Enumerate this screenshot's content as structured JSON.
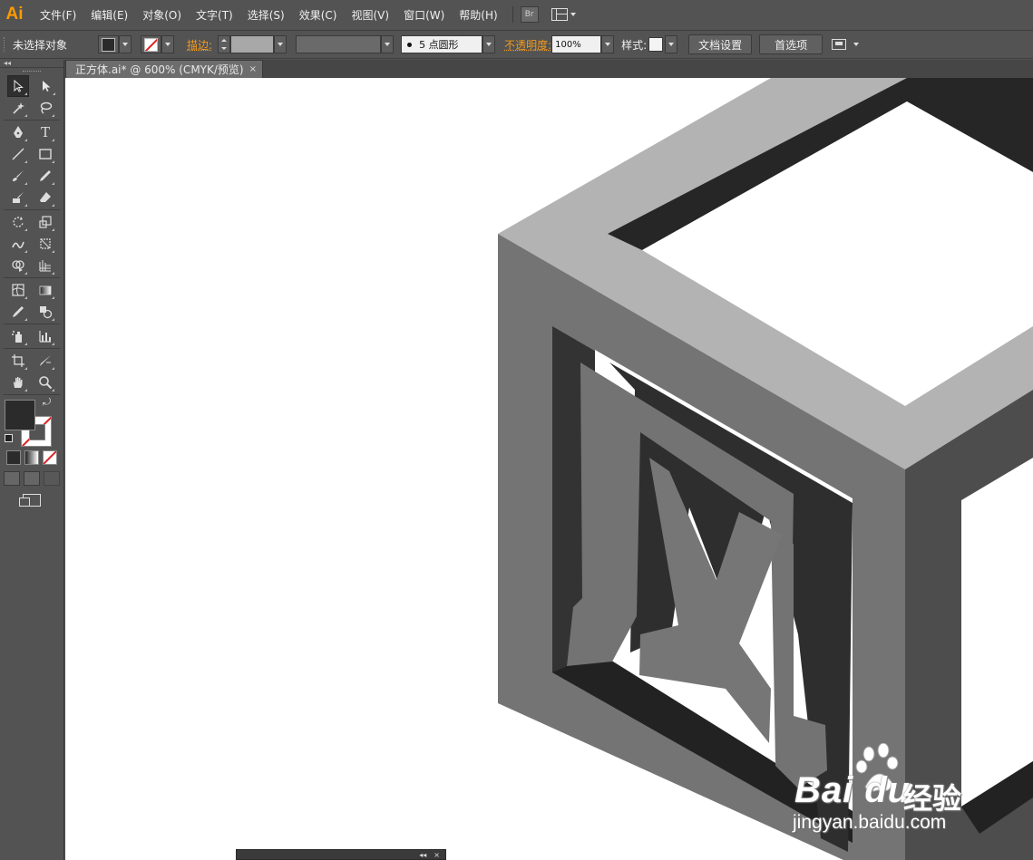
{
  "app": {
    "logo": "Ai",
    "menu": [
      "文件(F)",
      "编辑(E)",
      "对象(O)",
      "文字(T)",
      "选择(S)",
      "效果(C)",
      "视图(V)",
      "窗口(W)",
      "帮助(H)"
    ],
    "bridge_label": "Br"
  },
  "control_bar": {
    "selection_status": "未选择对象",
    "stroke_label": "描边:",
    "brush_size": "5",
    "brush_name": "点圆形",
    "opacity_label": "不透明度:",
    "opacity_value": "100%",
    "style_label": "样式:",
    "doc_setup_button": "文档设置",
    "preferences_button": "首选项"
  },
  "document": {
    "tab_title": "正方体.ai* @ 600% (CMYK/预览)",
    "close_glyph": "×"
  },
  "tools": {
    "collapse_glyph": "◂◂",
    "type_glyph": "T"
  },
  "float_panel": {
    "collapse_glyph": "◂◂",
    "close_glyph": "×"
  },
  "watermark": {
    "brand": "Bai du",
    "cn": "经验",
    "url": "jingyan.baidu.com"
  },
  "colors": {
    "ui_bg": "#535353",
    "accent_orange": "#f29a1d",
    "cube_top": "#b3b3b3",
    "cube_front": "#747474",
    "cube_side": "#4d4d4d",
    "cube_inner_dark": "#262626"
  }
}
